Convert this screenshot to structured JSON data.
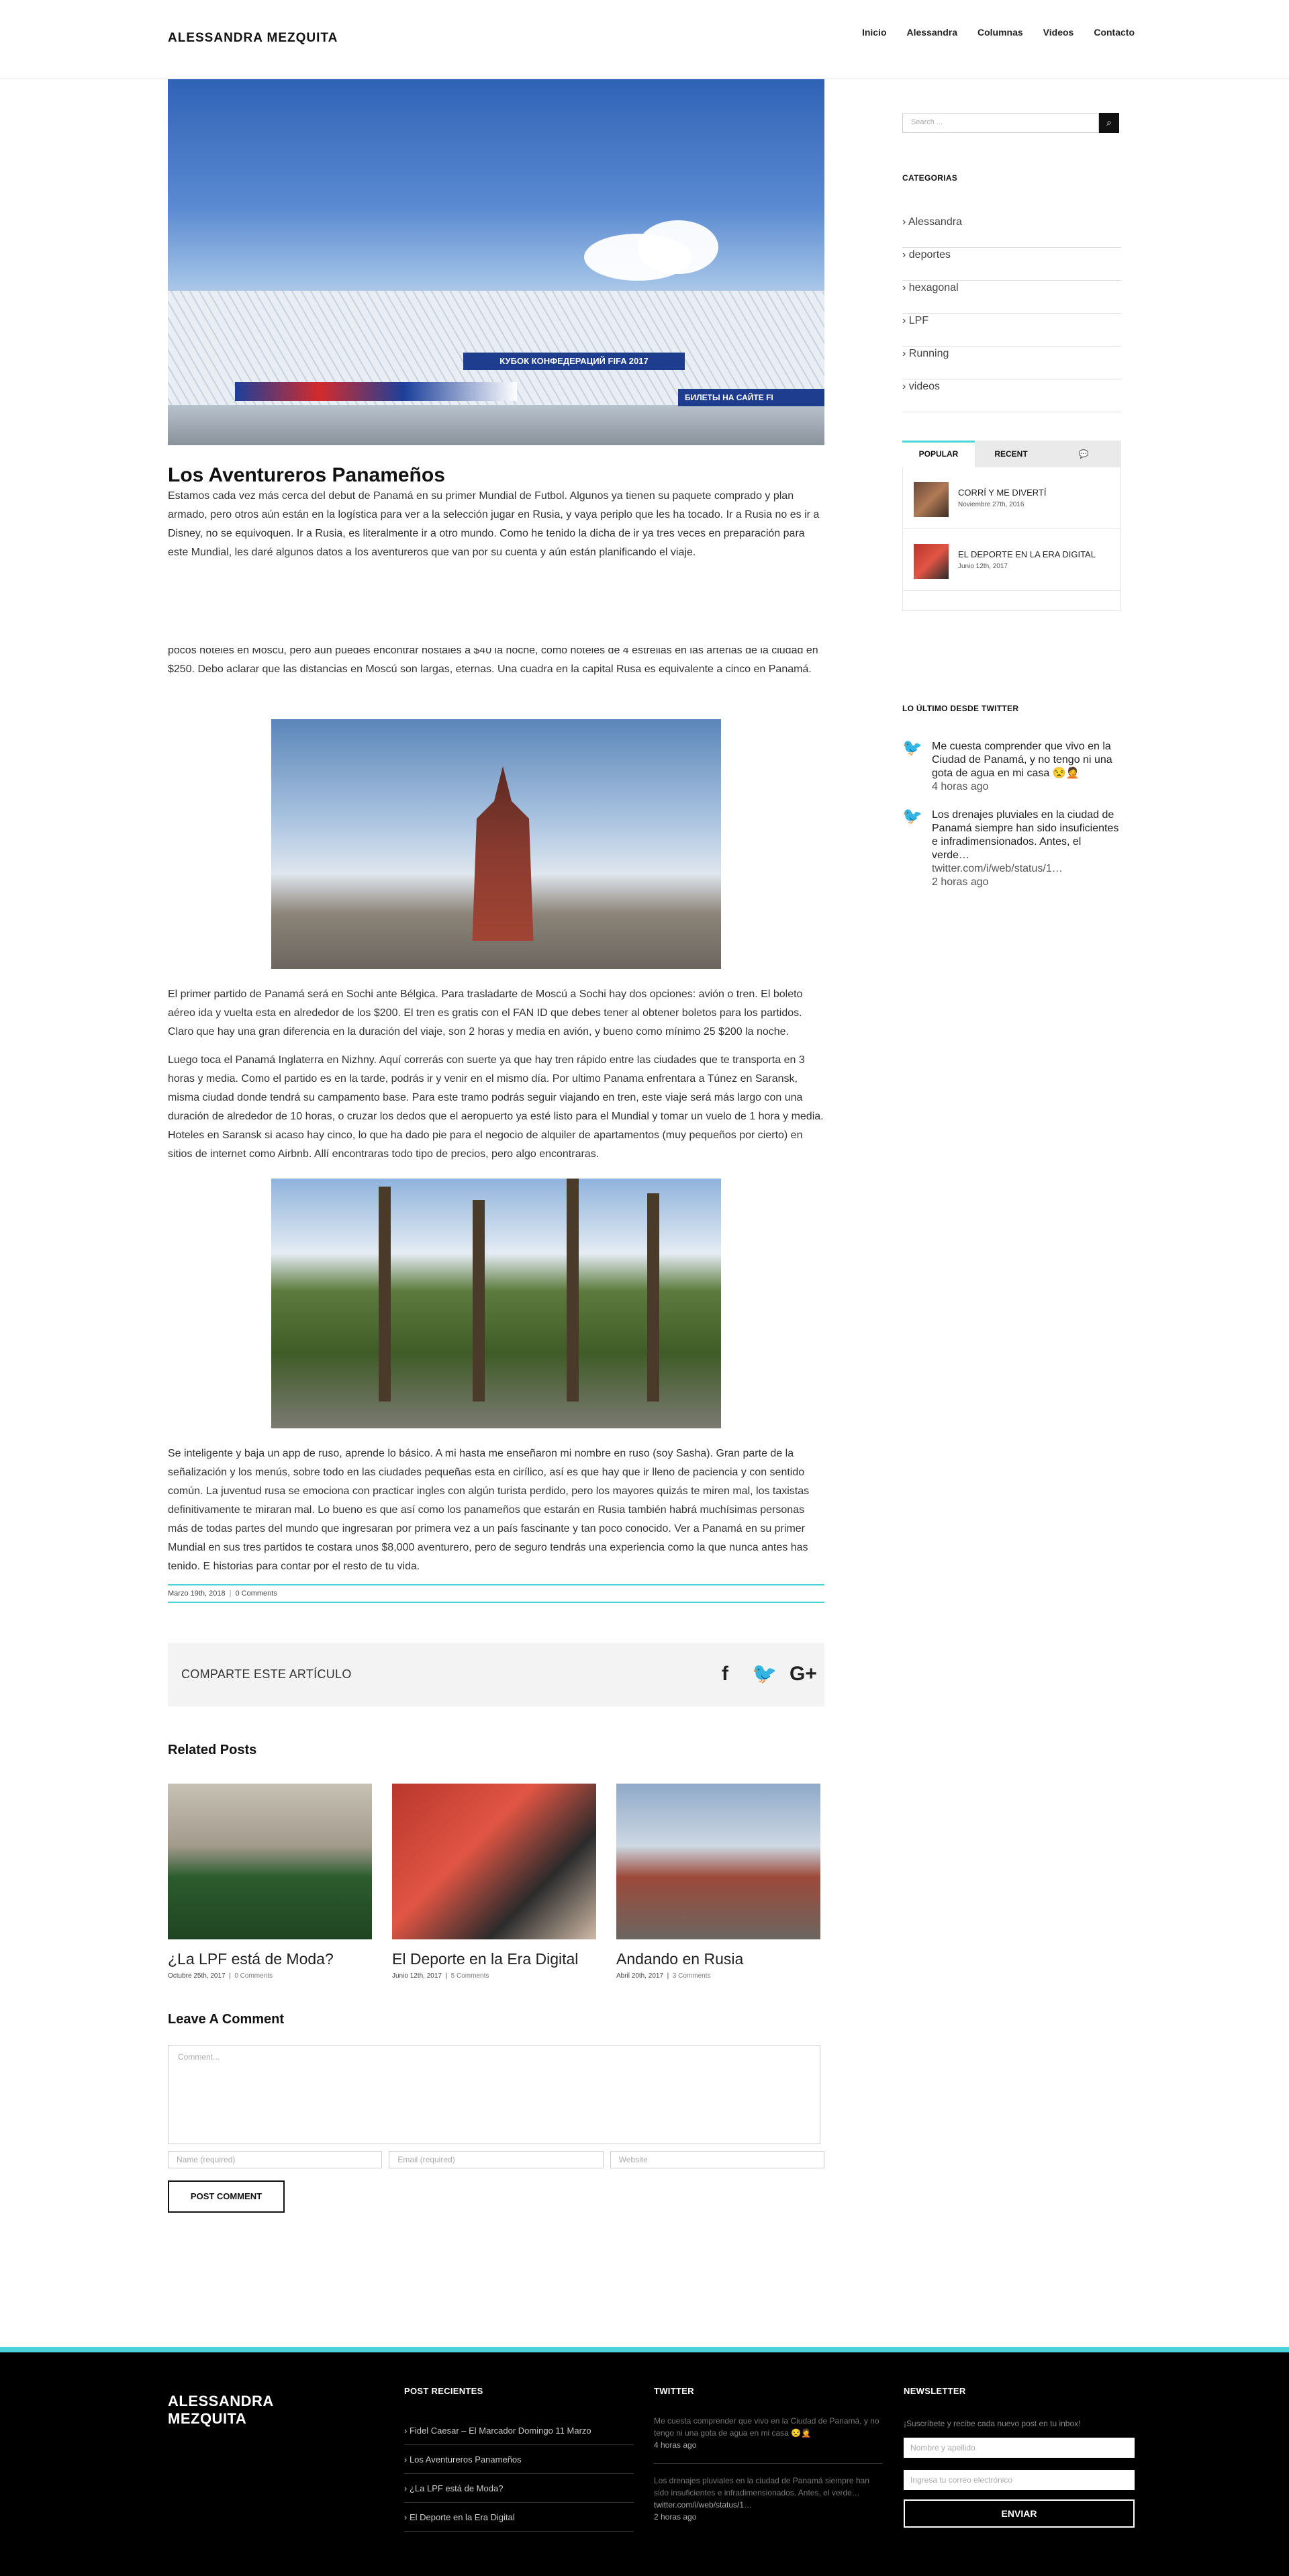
{
  "header": {
    "logo": "ALESSANDRA MEZQUITA",
    "nav": [
      "Inicio",
      "Alessandra",
      "Columnas",
      "Videos",
      "Contacto"
    ]
  },
  "post": {
    "hero_text_1": "КУБОК КОНФЕДЕРАЦИЙ FIFA 2017",
    "hero_text_2": "БИЛЕТЫ НА САЙТЕ FI",
    "title": "Los Aventureros Panameños",
    "p1": "Estamos cada vez más cerca del debut de Panamá en su primer Mundial de Futbol. Algunos ya tienen su paquete comprado y plan armado, pero otros aún están en la logística para ver a la selección jugar en Rusia, y vaya periplo que les ha tocado. Ir a Rusia no es ir a Disney, no se equivoquen. Ir a Rusia, es literalmente ir a otro mundo. Como he tenido la dicha de ir ya tres veces en preparación para este Mundial, les daré algunos datos a los aventureros que van por su cuenta y aún están planificando el viaje.",
    "p2": "pocos hoteles en Moscú, pero aún puedes encontrar hostales a $40 la noche, como hoteles de 4 estrellas en las arterias de la ciudad en $250. Debo aclarar que las distancias en Moscú son largas, eternas. Una cuadra en la capital Rusa es equivalente a cinco en Panamá.",
    "p3": "El primer partido de Panamá será en Sochi ante Bélgica. Para trasladarte de Moscú a Sochi hay dos opciones: avión o tren. El boleto aéreo ida y vuelta esta en alrededor de los $200. El tren es gratis con el FAN ID que debes tener al obtener boletos para los partidos. Claro que hay una gran diferencia en la duración del viaje, son 2 horas y media en avión, y bueno como mínimo 25 $200 la noche.",
    "p4": "Luego toca el Panamá Inglaterra en Nizhny. Aquí correrás con suerte ya que hay tren rápido entre las ciudades que te transporta en 3 horas y media. Como el partido es en la tarde, podrás ir y venir en el mismo día. Por ultimo Panama enfrentara a Túnez en Saransk, misma ciudad donde tendrá su campamento base. Para este tramo podrás seguir viajando en tren, este viaje será más largo con una duración de alrededor de 10 horas, o cruzar los dedos que el aeropuerto ya esté listo para el Mundial y tomar un vuelo de 1 hora y media. Hoteles en Saransk si acaso hay cinco, lo que ha dado pie para el negocio de alquiler de apartamentos (muy pequeños por cierto) en sitios de internet como Airbnb. Allí encontraras todo tipo de precios, pero algo encontraras.",
    "p5": "Se inteligente y baja un app de ruso, aprende lo básico. A mi hasta me enseñaron mi nombre en ruso (soy Sasha). Gran parte de la señalización y los menús, sobre todo en las ciudades pequeñas esta en cirílico, así es que hay que ir lleno de paciencia y con sentido común. La juventud rusa se emociona con practicar ingles con algún turista perdido, pero los mayores quizás te miren mal, los taxistas definitivamente te miraran mal. Lo bueno es que así como los panameños que estarán en Rusia también habrá muchísimas personas más de todas partes del mundo que ingresaran por primera vez a un país fascinante y tan poco conocido. Ver a Panamá en su primer Mundial en sus tres partidos te costara unos $8,000 aventurero, pero de seguro tendrás una experiencia como la que nunca antes has tenido. E historias para contar por el resto de tu vida.",
    "date": "Marzo 19th, 2018",
    "comments": "0 Comments"
  },
  "share": {
    "label": "COMPARTE ESTE ARTÍCULO",
    "icons": [
      "facebook-icon",
      "twitter-icon",
      "google-plus-icon"
    ],
    "glyphs": [
      "f",
      "🐦",
      "G+"
    ]
  },
  "related": {
    "title": "Related Posts",
    "items": [
      {
        "title": "¿La LPF está de Moda?",
        "date": "Octubre 25th, 2017",
        "comments": "0 Comments"
      },
      {
        "title": "El Deporte en la Era Digital",
        "date": "Junio 12th, 2017",
        "comments": "5 Comments"
      },
      {
        "title": "Andando en Rusia",
        "date": "Abril 20th, 2017",
        "comments": "3 Comments"
      }
    ]
  },
  "comment_form": {
    "title": "Leave A Comment",
    "comment_placeholder": "Comment...",
    "name_placeholder": "Name (required)",
    "email_placeholder": "Email (required)",
    "website_placeholder": "Website",
    "submit": "POST COMMENT"
  },
  "sidebar": {
    "search_placeholder": "Search ...",
    "categories_title": "CATEGORIAS",
    "categories": [
      "Alessandra",
      "deportes",
      "hexagonal",
      "LPF",
      "Running",
      "videos"
    ],
    "tabs": [
      "POPULAR",
      "RECENT",
      "💬"
    ],
    "popular": [
      {
        "title": "CORRÍ Y ME DIVERTÍ",
        "date": "Noviembre 27th, 2016"
      },
      {
        "title": "EL DEPORTE EN LA ERA DIGITAL",
        "date": "Junio 12th, 2017"
      }
    ],
    "twitter_title": "LO ÚLTIMO DESDE TWITTER",
    "tweets": [
      {
        "text": "Me cuesta comprender que vivo en la Ciudad de Panamá, y no tengo ni una gota de agua en mi casa 😒🤦",
        "link": "",
        "ago": "4 horas ago"
      },
      {
        "text": "Los drenajes pluviales en la ciudad de Panamá siempre han sido insuficientes e infradimensionados. Antes, el verde…",
        "link": "twitter.com/i/web/status/1…",
        "ago": "2 horas ago"
      }
    ]
  },
  "footer": {
    "logo": "ALESSANDRA MEZQUITA",
    "recent_title": "POST RECIENTES",
    "recent": [
      "Fidel Caesar – El Marcador Domingo 11 Marzo",
      "Los Aventureros Panameños",
      "¿La LPF está de Moda?",
      "El Deporte en la Era Digital"
    ],
    "twitter_title": "TWITTER",
    "tweets": [
      {
        "text": "Me cuesta comprender que vivo en la Ciudad de Panamá, y no tengo ni una gota de agua en mi casa 😒🤦",
        "link": "",
        "ago": "4 horas ago"
      },
      {
        "text": "Los drenajes pluviales en la ciudad de Panamá siempre han sido insuficientes e infradimensionados. Antes, el verde…",
        "link": "twitter.com/i/web/status/1…",
        "ago": "2 horas ago"
      }
    ],
    "newsletter_title": "NEWSLETTER",
    "newsletter_text": "¡Suscríbete y recibe cada nuevo post en tu inbox!",
    "name_placeholder": "Nombre y apellido",
    "email_placeholder": "Ingresa tu correo electrónico",
    "submit": "ENVIAR"
  },
  "colors": {
    "accent": "#4ad4da",
    "dark": "#111111"
  }
}
